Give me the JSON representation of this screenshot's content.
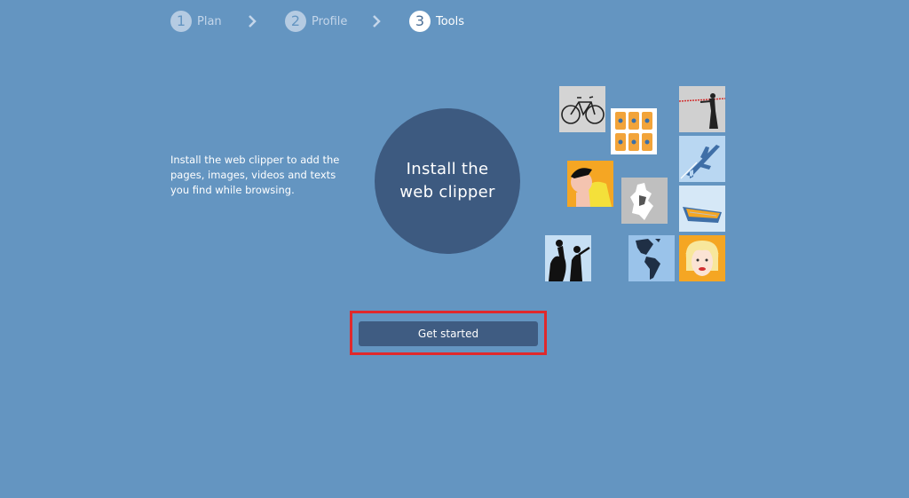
{
  "steps": [
    {
      "number": "1",
      "label": "Plan",
      "state": "inactive"
    },
    {
      "number": "2",
      "label": "Profile",
      "state": "inactive"
    },
    {
      "number": "3",
      "label": "Tools",
      "state": "active"
    }
  ],
  "intro": {
    "description": "Install the web clipper to add the pages, images, videos and texts you find while browsing.",
    "circle_text": "Install the web clipper"
  },
  "actions": {
    "get_started_label": "Get started"
  },
  "tiles": [
    "bicycle",
    "cans",
    "tightrope-walker",
    "airplane",
    "cartoon-boy",
    "map-silhouette",
    "rowboat",
    "musicians",
    "americas-map",
    "marilyn-portrait"
  ],
  "colors": {
    "background": "#6495c1",
    "circle": "#3d5a80",
    "button": "#3f5c82",
    "highlight": "#e0292c"
  }
}
